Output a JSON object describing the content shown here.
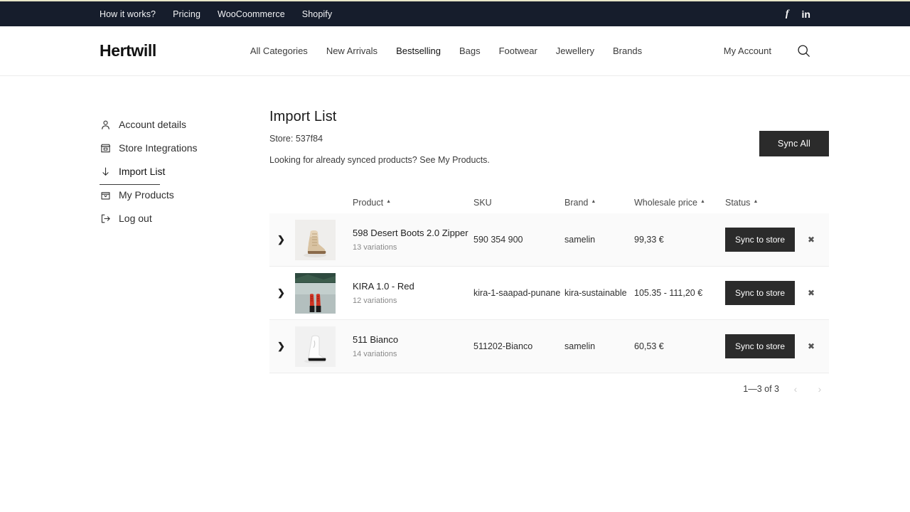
{
  "topbar": {
    "links": [
      {
        "label": "How it works?"
      },
      {
        "label": "Pricing"
      },
      {
        "label": "WooCoommerce"
      },
      {
        "label": "Shopify"
      }
    ],
    "social": [
      {
        "name": "facebook-icon",
        "glyph": "f"
      },
      {
        "name": "linkedin-icon",
        "glyph": "in"
      }
    ],
    "bg_color": "#161d2c",
    "accent_top_line": "#e8e6c8"
  },
  "header": {
    "logo": "Hertwill",
    "nav": [
      {
        "label": "All Categories"
      },
      {
        "label": "New Arrivals"
      },
      {
        "label": "Bestselling"
      },
      {
        "label": "Bags"
      },
      {
        "label": "Footwear"
      },
      {
        "label": "Jewellery"
      },
      {
        "label": "Brands"
      }
    ],
    "account_label": "My Account",
    "search_icon": "search-icon"
  },
  "sidebar": {
    "items": [
      {
        "label": "Account details",
        "icon": "user-icon",
        "active": false
      },
      {
        "label": "Store Integrations",
        "icon": "store-icon",
        "active": false
      },
      {
        "label": "Import List",
        "icon": "download-icon",
        "active": true
      },
      {
        "label": "My Products",
        "icon": "package-icon",
        "active": false
      },
      {
        "label": "Log out",
        "icon": "logout-icon",
        "active": false
      }
    ]
  },
  "main": {
    "title": "Import List",
    "store_line": "Store: 537f84",
    "synced_line": "Looking for already synced products? See My Products.",
    "sync_all_label": "Sync All",
    "accent_dark": "#2b2b2b"
  },
  "table": {
    "headers": [
      {
        "label": "Product",
        "sortable": true,
        "caret": "▲"
      },
      {
        "label": "SKU",
        "sortable": false,
        "caret": ""
      },
      {
        "label": "Brand",
        "sortable": true,
        "caret": "▲"
      },
      {
        "label": "Wholesale price",
        "sortable": true,
        "caret": "▲"
      },
      {
        "label": "Status",
        "sortable": true,
        "caret": "▲"
      }
    ],
    "rows": [
      {
        "expand": "❯",
        "thumb": "boot-beige",
        "product": "598 Desert Boots 2.0 Zipper",
        "variations": "13 variations",
        "sku": "590 354 900",
        "brand": "samelin",
        "price": "99,33 €",
        "sync_label": "Sync to store",
        "delete_glyph": "✖"
      },
      {
        "expand": "❯",
        "thumb": "boot-red-landscape",
        "product": "KIRA 1.0 - Red",
        "variations": "12 variations",
        "sku": "kira-1-saapad-punane",
        "brand": "kira-sustainable",
        "price": "105.35 - 111,20 €",
        "sync_label": "Sync to store",
        "delete_glyph": "✖"
      },
      {
        "expand": "❯",
        "thumb": "boot-white",
        "product": "511 Bianco",
        "variations": "14 variations",
        "sku": "511202-Bianco",
        "brand": "samelin",
        "price": "60,53 €",
        "sync_label": "Sync to store",
        "delete_glyph": "✖"
      }
    ],
    "footer": {
      "range_label": "1—3 of 3",
      "prev_glyph": "‹",
      "next_glyph": "›"
    }
  }
}
